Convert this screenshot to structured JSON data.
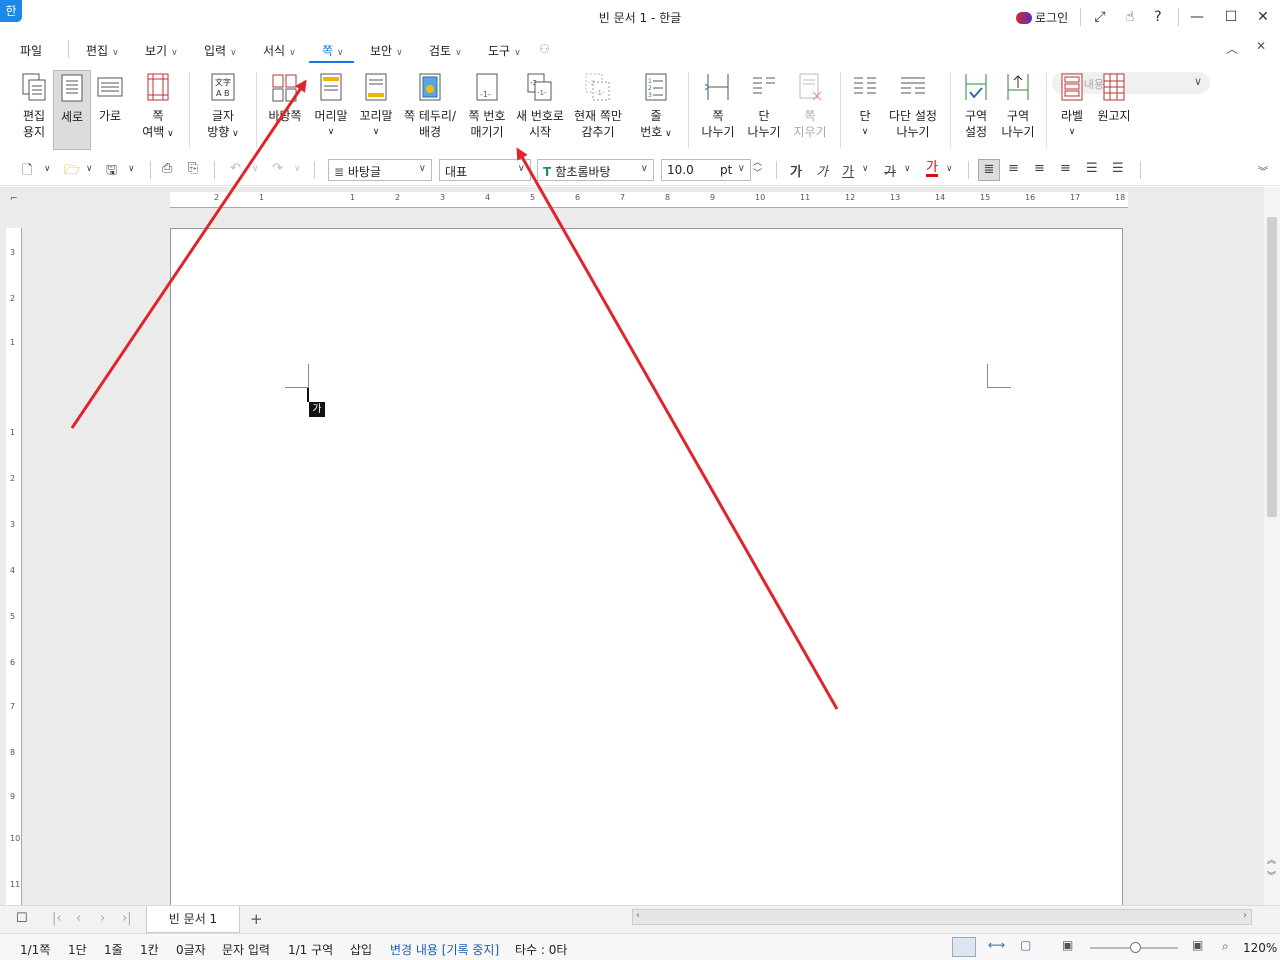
{
  "window": {
    "app_icon": "한",
    "title": "빈 문서 1 - 한글",
    "login_label": "로그인",
    "icons": [
      "expand-icon",
      "hand-icon",
      "help-icon",
      "minimize-icon",
      "maximize-icon",
      "close-icon"
    ]
  },
  "menu": {
    "file": "파일",
    "items": [
      "편집",
      "보기",
      "입력",
      "서식",
      "쪽",
      "보안",
      "검토",
      "도구"
    ],
    "active": "쪽",
    "search_placeholder": "찾을 내용"
  },
  "ribbon": {
    "groups": [
      {
        "id": "edit-paper",
        "line1": "편집",
        "line2": "용지"
      },
      {
        "id": "portrait",
        "line1": "세로",
        "line2": ""
      },
      {
        "id": "landscape",
        "line1": "가로",
        "line2": ""
      },
      {
        "id": "page-margin",
        "line1": "쪽",
        "line2": "여백"
      },
      {
        "id": "text-direction",
        "line1": "글자",
        "line2": "방향"
      },
      {
        "id": "master-page",
        "line1": "바탕쪽",
        "line2": ""
      },
      {
        "id": "header",
        "line1": "머리말",
        "line2": ""
      },
      {
        "id": "footer",
        "line1": "꼬리말",
        "line2": ""
      },
      {
        "id": "page-border",
        "line1": "쪽 테두리/",
        "line2": "배경"
      },
      {
        "id": "page-number",
        "line1": "쪽 번호",
        "line2": "매기기"
      },
      {
        "id": "new-number",
        "line1": "새 번호로",
        "line2": "시작"
      },
      {
        "id": "hide-page",
        "line1": "현재 쪽만",
        "line2": "감추기"
      },
      {
        "id": "line-number",
        "line1": "줄",
        "line2": "번호"
      },
      {
        "id": "page-break",
        "line1": "쪽",
        "line2": "나누기"
      },
      {
        "id": "column-break",
        "line1": "단",
        "line2": "나누기"
      },
      {
        "id": "page-delete",
        "line1": "쪽",
        "line2": "지우기"
      },
      {
        "id": "columns",
        "line1": "단",
        "line2": ""
      },
      {
        "id": "multi-column-break",
        "line1": "다단 설정",
        "line2": "나누기"
      },
      {
        "id": "section-settings",
        "line1": "구역",
        "line2": "설정"
      },
      {
        "id": "section-break",
        "line1": "구역",
        "line2": "나누기"
      },
      {
        "id": "label",
        "line1": "라벨",
        "line2": ""
      },
      {
        "id": "manuscript",
        "line1": "원고지",
        "line2": ""
      }
    ]
  },
  "format_bar": {
    "style": "바탕글",
    "lang": "대표",
    "font": "함초롬바탕",
    "font_size": "10.0",
    "unit": "pt",
    "char_buttons": [
      "가",
      "가",
      "가",
      "가",
      "가"
    ]
  },
  "rulers": {
    "h_numbers": [
      "2",
      "1",
      "1",
      "2",
      "3",
      "4",
      "5",
      "6",
      "7",
      "8",
      "9",
      "10",
      "11",
      "12",
      "13",
      "14",
      "15",
      "16",
      "17",
      "18"
    ],
    "v_numbers": [
      "3",
      "2",
      "1",
      "1",
      "2",
      "3",
      "4",
      "5",
      "6",
      "7",
      "8",
      "9",
      "10",
      "11"
    ]
  },
  "document": {
    "ime_label": "가"
  },
  "tabs": {
    "doc_tab": "빈 문서 1",
    "add": "+"
  },
  "status": {
    "page": "1/1쪽",
    "column": "1단",
    "line": "1줄",
    "col": "1칸",
    "chars": "0글자",
    "mode": "문자 입력",
    "section": "1/1 구역",
    "insert": "삽입",
    "track": "변경 내용 [기록 중지]",
    "keystrokes": "타수 : 0타",
    "zoom": "120%"
  },
  "colors": {
    "accent": "#1a73e8",
    "annotation_arrow": "#e0242b"
  }
}
